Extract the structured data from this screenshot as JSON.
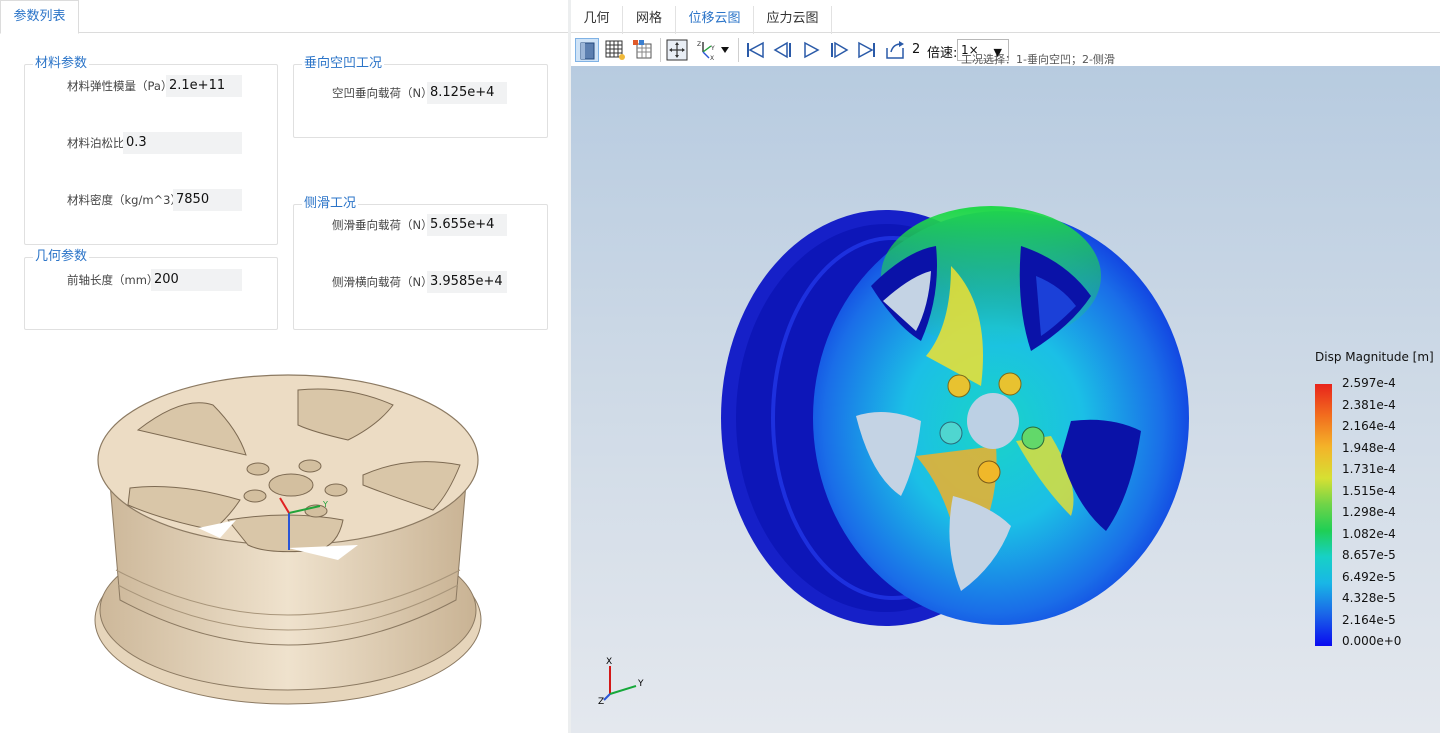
{
  "left_panel": {
    "tab_label": "参数列表",
    "material_group": {
      "title": "材料参数",
      "fields": [
        {
          "label": "材料弹性模量（Pa）",
          "value": "2.1e+11"
        },
        {
          "label": "材料泊松比",
          "value": "0.3"
        },
        {
          "label": "材料密度（kg/m^3）",
          "value": "7850"
        }
      ]
    },
    "geometry_group": {
      "title": "几何参数",
      "fields": [
        {
          "label": "前轴长度（mm）",
          "value": "200"
        }
      ]
    },
    "vertical_group": {
      "title": "垂向空凹工况",
      "fields": [
        {
          "label": "空凹垂向载荷（N）",
          "value": "8.125e+4"
        }
      ]
    },
    "side_group": {
      "title": "侧滑工况",
      "fields": [
        {
          "label": "侧滑垂向载荷（N）",
          "value": "5.655e+4"
        },
        {
          "label": "侧滑横向载荷（N）",
          "value": "3.9585e+4"
        }
      ]
    },
    "model_axes": {
      "y": "Y",
      "model_color": "#ecdcc4"
    }
  },
  "right_panel": {
    "tabs": [
      {
        "label": "几何",
        "active": false
      },
      {
        "label": "网格",
        "active": false
      },
      {
        "label": "位移云图",
        "active": true
      },
      {
        "label": "应力云图",
        "active": false
      }
    ],
    "toolbar": {
      "icons": [
        "view-cube-icon",
        "mesh-grid-icon",
        "table-probe-icon",
        "fit-view-icon",
        "axes-orient-icon",
        "first-frame-icon",
        "prev-frame-icon",
        "play-icon",
        "next-frame-icon",
        "last-frame-icon",
        "export-icon"
      ],
      "case_number": "2",
      "speed_label": "倍速:",
      "speed_value": "1×",
      "case_hint": "工况选择：1-垂向空凹；2-侧滑"
    },
    "legend": {
      "title": "Disp Magnitude [m]",
      "labels": [
        "2.597e-4",
        "2.381e-4",
        "2.164e-4",
        "1.948e-4",
        "1.731e-4",
        "1.515e-4",
        "1.298e-4",
        "1.082e-4",
        "8.657e-5",
        "6.492e-5",
        "4.328e-5",
        "2.164e-5",
        "0.000e+0"
      ],
      "max_color": "#e8241c",
      "min_color": "#0a0af0"
    },
    "triad": {
      "x": "X",
      "y": "Y",
      "z": "Z"
    }
  }
}
